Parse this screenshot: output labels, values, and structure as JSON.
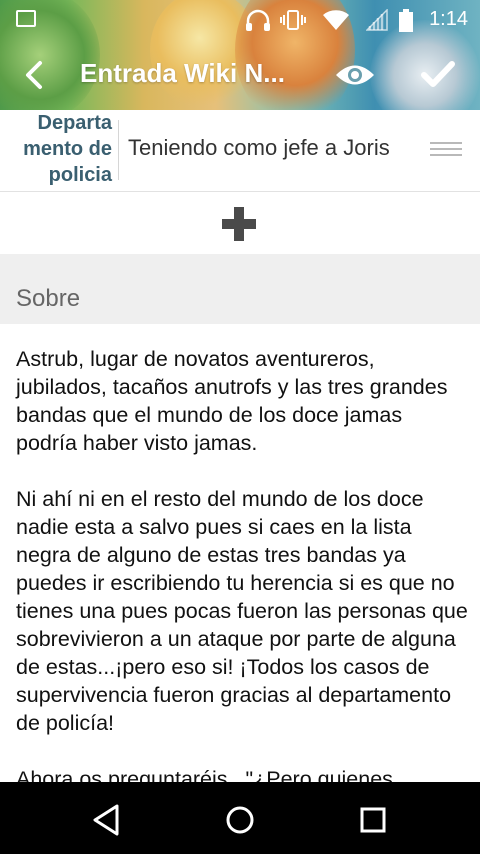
{
  "status_bar": {
    "time": "1:14",
    "icons": [
      "gallery-icon",
      "headset-icon",
      "vibrate-icon",
      "wifi-icon",
      "signal-icon",
      "battery-icon"
    ]
  },
  "toolbar": {
    "title": "Entrada Wiki N...",
    "icons": [
      "back-arrow-icon",
      "eye-icon",
      "check-icon"
    ]
  },
  "category": {
    "label_lines": [
      "Departa",
      "mento de",
      "policia"
    ],
    "value": "Teniendo como jefe a Joris",
    "menu_icon": "menu-lines-icon"
  },
  "add_icon": "plus-icon",
  "section": {
    "title": "Sobre"
  },
  "body": {
    "paragraph_1": "Astrub, lugar de novatos aventureros, jubilados, tacaños anutrofs y las tres grandes bandas que el mundo de los doce jamas podría haber visto jamas.",
    "paragraph_2": "Ni ahí ni en el resto del mundo de los doce nadie esta a salvo pues si caes en la lista negra de alguno de estas tres bandas ya puedes ir escribiendo tu herencia si es que no tienes una pues pocas fueron las personas que sobrevivieron a un ataque por parte de alguna de estas...¡pero eso si! ¡Todos los casos de supervivencia fueron gracias al departamento de policía!",
    "paragraph_3": "Ahora os preguntaréis...\"¿Pero quienes"
  },
  "nav_bar": {
    "icons": [
      "back-triangle-icon",
      "home-circle-icon",
      "recents-square-icon"
    ]
  },
  "colors": {
    "category_label": "#3a5f70",
    "section_bg": "#efefef",
    "nav_bg": "#000000"
  }
}
